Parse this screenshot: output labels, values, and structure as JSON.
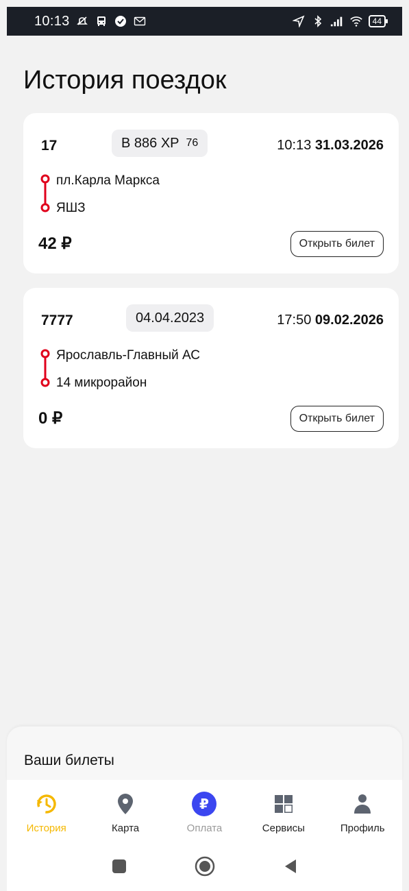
{
  "status_bar": {
    "time": "10:13",
    "battery": "44"
  },
  "page": {
    "title": "История поездок"
  },
  "trips": [
    {
      "route_number": "17",
      "plate": "В 886 ХР",
      "plate_region": "76",
      "time": "10:13",
      "date": "31.03.2026",
      "from": "пл.Карла Маркса",
      "to": "ЯШЗ",
      "price": "42 ₽",
      "open_button": "Открыть билет"
    },
    {
      "route_number": "7777",
      "plate": "04.04.2023",
      "plate_region": "",
      "time": "17:50",
      "date": "09.02.2026",
      "from": "Ярославль-Главный АС",
      "to": "14 микрорайон",
      "price": "0 ₽",
      "open_button": "Открыть билет"
    }
  ],
  "tickets_sheet": {
    "title": "Ваши билеты"
  },
  "bottom_nav": {
    "items": [
      {
        "label": "История",
        "icon": "history-icon"
      },
      {
        "label": "Карта",
        "icon": "map-pin-icon"
      },
      {
        "label": "Оплата",
        "icon": "ruble-icon"
      },
      {
        "label": "Сервисы",
        "icon": "grid-icon"
      },
      {
        "label": "Профиль",
        "icon": "profile-icon"
      }
    ],
    "active_color": "#f5b800",
    "pay_color": "#3b46f0"
  },
  "colors": {
    "route_line": "#e0001b",
    "background": "#f2f2f2"
  }
}
